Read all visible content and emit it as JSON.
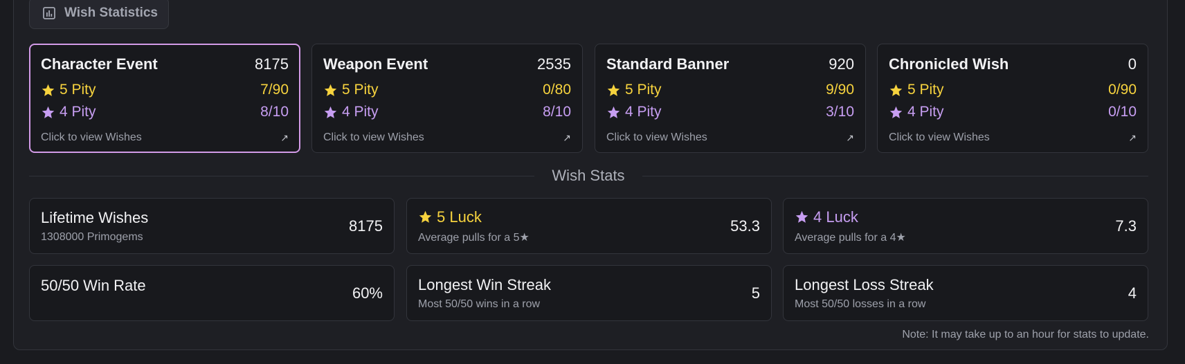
{
  "header": {
    "tab_label": "Wish Statistics",
    "tab_icon": "bar-chart-icon"
  },
  "banners": [
    {
      "title": "Character Event",
      "count": "8175",
      "pity5_label": "5 Pity",
      "pity5": "7/90",
      "pity4_label": "4 Pity",
      "pity4": "8/10",
      "link": "Click to view Wishes"
    },
    {
      "title": "Weapon Event",
      "count": "2535",
      "pity5_label": "5 Pity",
      "pity5": "0/80",
      "pity4_label": "4 Pity",
      "pity4": "8/10",
      "link": "Click to view Wishes"
    },
    {
      "title": "Standard Banner",
      "count": "920",
      "pity5_label": "5 Pity",
      "pity5": "9/90",
      "pity4_label": "4 Pity",
      "pity4": "3/10",
      "link": "Click to view Wishes"
    },
    {
      "title": "Chronicled Wish",
      "count": "0",
      "pity5_label": "5 Pity",
      "pity5": "0/90",
      "pity4_label": "4 Pity",
      "pity4": "0/10",
      "link": "Click to view Wishes"
    }
  ],
  "selected_banner": "Character Event",
  "section_title": "Wish Stats",
  "stats": [
    {
      "title": "Lifetime Wishes",
      "sub": "1308000 Primogems",
      "value": "8175"
    },
    {
      "title": "5 Luck",
      "sub": "Average pulls for a 5★",
      "value": "53.3"
    },
    {
      "title": "4 Luck",
      "sub": "Average pulls for a 4★",
      "value": "7.3"
    },
    {
      "title": "50/50 Win Rate",
      "sub": "",
      "value": "60%"
    },
    {
      "title": "Longest Win Streak",
      "sub": "Most 50/50 wins in a row",
      "value": "5"
    },
    {
      "title": "Longest Loss Streak",
      "sub": "Most 50/50 losses in a row",
      "value": "4"
    }
  ],
  "note": "Note: It may take up to an hour for stats to update.",
  "colors": {
    "gold": "#f7d33e",
    "purple": "#c79ef2",
    "selected_border": "#d39be8",
    "background": "#1a1b1f"
  }
}
